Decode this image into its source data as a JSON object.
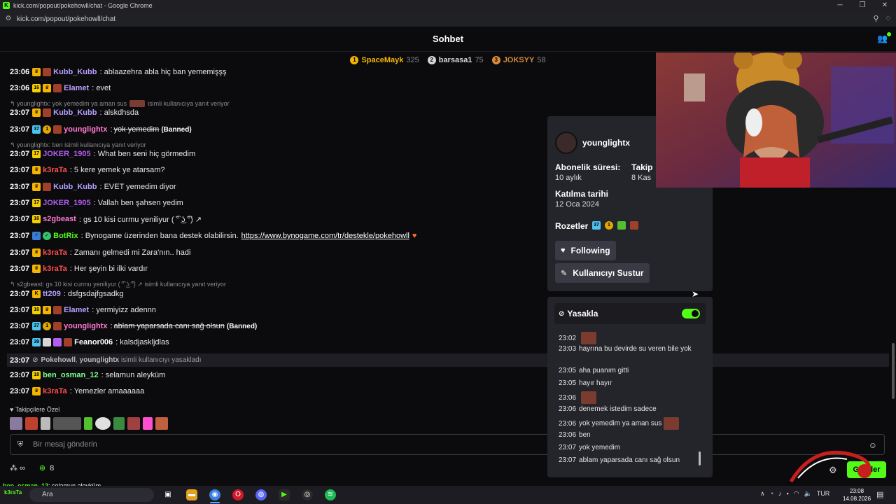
{
  "browser": {
    "window_title": "kick.com/popout/pokehowll/chat - Google Chrome",
    "url": "kick.com/popout/pokehowll/chat"
  },
  "header": {
    "title": "Sohbet"
  },
  "leaderboard": [
    {
      "rank": "1",
      "name": "SpaceMayk",
      "points": "325",
      "color": "#f5b400"
    },
    {
      "rank": "2",
      "name": "barsasa1",
      "points": "75",
      "color": "#d6d6d6"
    },
    {
      "rank": "3",
      "name": "JOKSYY",
      "points": "58",
      "color": "#d98a3a"
    }
  ],
  "messages": [
    {
      "time": "23:06",
      "user": "Kubb_Kubb",
      "color": "#b7a0ff",
      "text": ": ablaazehra abla hiç ban yememişşş"
    },
    {
      "time": "23:06",
      "sub": "16",
      "user": "Elamet",
      "color": "#b7a0ff",
      "text": ": evet"
    },
    {
      "time": "23:07",
      "user": "Kubb_Kubb",
      "color": "#b7a0ff",
      "text": ": alskdhsda"
    },
    {
      "time": "23:07",
      "sub": "37",
      "og": "1",
      "user": "younglightx",
      "color": "#ff7ad1",
      "text": "yok yemedim",
      "banned": "(Banned)"
    },
    {
      "time": "23:07",
      "sub": "17",
      "user": "JOKER_1905",
      "color": "#b15df0",
      "text": ": What ben seni hiç görmedim"
    },
    {
      "time": "23:07",
      "user": "k3raTa",
      "color": "#ff4d4d",
      "text": ": 5 kere yemek ye atarsam?"
    },
    {
      "time": "23:07",
      "user": "Kubb_Kubb",
      "color": "#b7a0ff",
      "text": ": EVET yemedim diyor"
    },
    {
      "time": "23:07",
      "sub": "17",
      "user": "JOKER_1905",
      "color": "#b15df0",
      "text": ": Vallah ben şahsen yedim"
    },
    {
      "time": "23:07",
      "sub": "16",
      "user": "s2gbeast",
      "color": "#ff7ad1",
      "text": ": gs 10 kisi curmu yeniliyur  ( ͡° ͜ʖ ͡°) ↗"
    },
    {
      "time": "23:07",
      "user": "BotRix",
      "color": "#53fc18",
      "text": ": Bynogame üzerinden bana destek olabilirsin.",
      "link": "https://www.bynogame.com/tr/destekle/pokehowll",
      "heart": "♥"
    },
    {
      "time": "23:07",
      "user": "k3raTa",
      "color": "#ff4d4d",
      "text": ": Zamanı gelmedi mi Zara'nın.. hadi"
    },
    {
      "time": "23:07",
      "user": "k3raTa",
      "color": "#ff4d4d",
      "text": ": Her şeyin bi ilki vardır"
    },
    {
      "time": "23:07",
      "user": "tt209",
      "color": "#b7a0ff",
      "text": ": dsfgsdajfgsadkg"
    },
    {
      "time": "23:07",
      "sub": "16",
      "user": "Elamet",
      "color": "#b7a0ff",
      "text": ": yermiyizz adennn"
    },
    {
      "time": "23:07",
      "sub": "37",
      "og": "1",
      "user": "younglightx",
      "color": "#ff7ad1",
      "text": "ablam yaparsada canı sağ olsun",
      "banned": "(Banned)"
    },
    {
      "time": "23:07",
      "sub": "39",
      "user": "Feanor006",
      "color": "#ffffff",
      "text": ": kalsdjaskljdlas"
    },
    {
      "time": "23:07",
      "sub": "18",
      "user": "ben_osman_12",
      "color": "#7dff8a",
      "text": ": selamun aleyküm"
    },
    {
      "time": "23:07",
      "user": "k3raTa",
      "color": "#ff4d4d",
      "text": ": Yemezler amaaaaaa"
    }
  ],
  "replies": [
    {
      "text_a": "younglightx: yok yemedim ya aman sus",
      "text_b": "isimli kullanıcıya yanıt veriyor"
    },
    {
      "text_a": "younglightx: ben isimli kullanıcıya yanıt veriyor",
      "text_b": ""
    },
    {
      "text_a": "s2gbeast: gs 10 kisi curmu yeniliyur  ( ͡° ͜ʖ ͡°) ↗",
      "text_b": "isimli kullanıcıya yanıt veriyor"
    }
  ],
  "ban_notice": {
    "time": "23:07",
    "moderator": "Pokehowll",
    "target": "younglightx",
    "text": "isimli kullanıcıyı yasakladı"
  },
  "followers_only": "Takipçilere Özel",
  "input": {
    "placeholder": "Bir mesaj gönderin"
  },
  "bottom": {
    "infinity": "∞",
    "kcoins": "8",
    "send_label": "Gönder"
  },
  "overlay_text": {
    "user": "ben_osman_12",
    "text": ": selamun aleyküm"
  },
  "user_card": {
    "username": "younglightx",
    "sub_label": "Abonelik süresi:",
    "sub_value": "10 aylık",
    "follow_label": "Takip",
    "follow_value": "8 Kas",
    "join_label": "Katılma tarihi",
    "join_value": "12 Oca 2024",
    "badges_label": "Rozetler",
    "following_btn": "Following",
    "mute_btn": "Kullanıcıyı Sustur"
  },
  "ban_panel": {
    "title": "Yasakla",
    "toggle_on": true,
    "log": [
      {
        "time": "23:02",
        "text": ""
      },
      {
        "time": "23:03",
        "text": "hayrına bu devirde su veren bile yok"
      },
      {
        "time": "23:05",
        "text": "aha puanım gitti"
      },
      {
        "time": "23:05",
        "text": "hayır hayır"
      },
      {
        "time": "23:06",
        "text": ""
      },
      {
        "time": "23:06",
        "text": "denemek istedim sadece"
      },
      {
        "time": "23:06",
        "text": "yok yemedim ya aman sus"
      },
      {
        "time": "23:06",
        "text": "ben"
      },
      {
        "time": "23:07",
        "text": "yok yemedim"
      },
      {
        "time": "23:07",
        "text": "ablam yaparsada canı sağ olsun"
      }
    ]
  },
  "taskbar": {
    "search_label": "Ara",
    "lang": "TUR",
    "time": "23:08",
    "date": "14.08.2026",
    "logo_text": "k3raTa",
    "overlay_msg": ": Yemezler amaaaaaa"
  },
  "colors": {
    "kick_green": "#53fc18",
    "background": "#0b0b0e",
    "card": "#24242b"
  }
}
